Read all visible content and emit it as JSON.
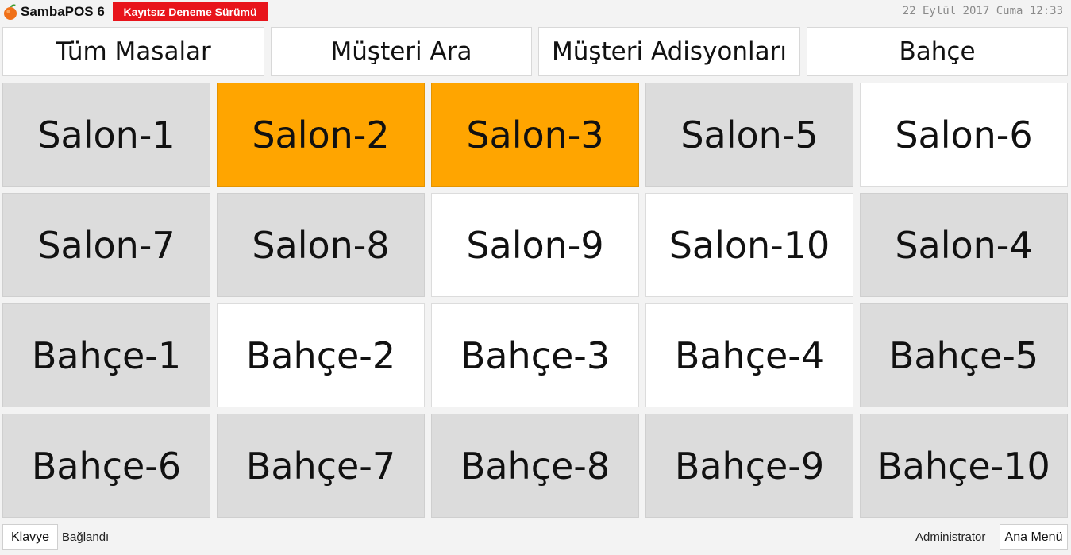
{
  "header": {
    "app_title": "SambaPOS 6",
    "trial_label": "Kayıtsız Deneme Sürümü",
    "datetime": "22 Eylül 2017 Cuma 12:33",
    "logo_icon": "orange-fruit-icon"
  },
  "nav": [
    {
      "label": "Tüm Masalar"
    },
    {
      "label": "Müşteri Ara"
    },
    {
      "label": "Müşteri Adisyonları"
    },
    {
      "label": "Bahçe"
    }
  ],
  "tables": [
    {
      "label": "Salon-1",
      "status": "gray"
    },
    {
      "label": "Salon-2",
      "status": "orange"
    },
    {
      "label": "Salon-3",
      "status": "orange"
    },
    {
      "label": "Salon-5",
      "status": "gray"
    },
    {
      "label": "Salon-6",
      "status": "white"
    },
    {
      "label": "Salon-7",
      "status": "gray"
    },
    {
      "label": "Salon-8",
      "status": "gray"
    },
    {
      "label": "Salon-9",
      "status": "white"
    },
    {
      "label": "Salon-10",
      "status": "white"
    },
    {
      "label": "Salon-4",
      "status": "gray"
    },
    {
      "label": "Bahçe-1",
      "status": "gray"
    },
    {
      "label": "Bahçe-2",
      "status": "white"
    },
    {
      "label": "Bahçe-3",
      "status": "white"
    },
    {
      "label": "Bahçe-4",
      "status": "white"
    },
    {
      "label": "Bahçe-5",
      "status": "gray"
    },
    {
      "label": "Bahçe-6",
      "status": "gray"
    },
    {
      "label": "Bahçe-7",
      "status": "gray"
    },
    {
      "label": "Bahçe-8",
      "status": "gray"
    },
    {
      "label": "Bahçe-9",
      "status": "gray"
    },
    {
      "label": "Bahçe-10",
      "status": "gray"
    }
  ],
  "colors": {
    "gray": "#dcdcdc",
    "orange": "#ffa500",
    "white": "#ffffff",
    "trial_badge": "#e8141b"
  },
  "footer": {
    "keyboard_label": "Klavye",
    "connection_status": "Bağlandı",
    "user": "Administrator",
    "main_menu_label": "Ana Menü"
  }
}
